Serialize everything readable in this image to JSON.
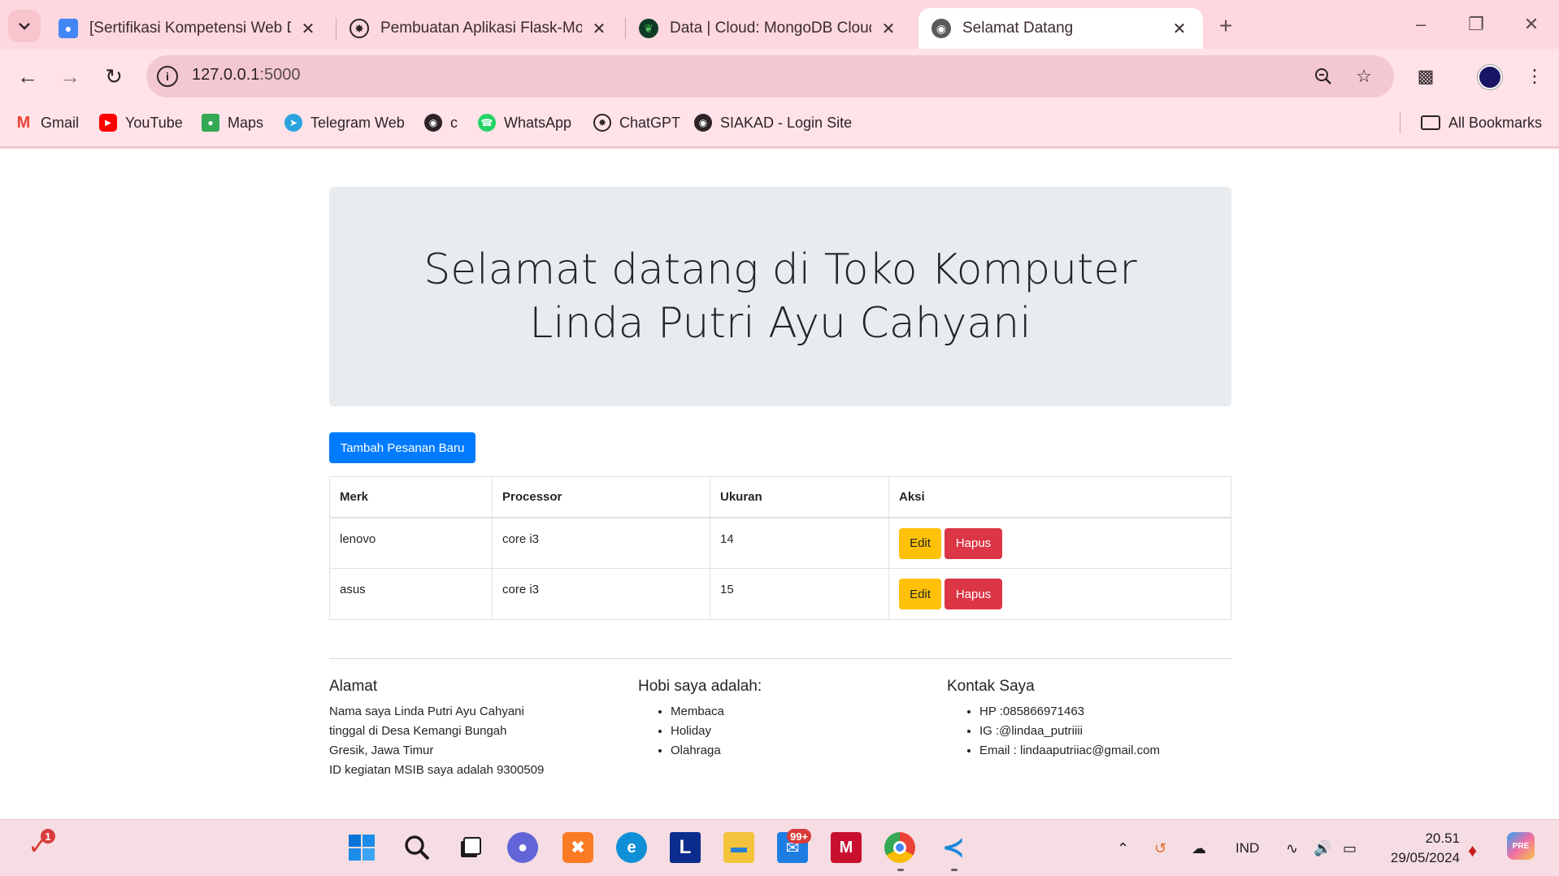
{
  "browser": {
    "tabs": [
      {
        "title": "[Sertifikasi Kompetensi Web De",
        "icon": "classroom-icon",
        "active": false
      },
      {
        "title": "Pembuatan Aplikasi Flask-Mong",
        "icon": "chatgpt-icon",
        "active": false
      },
      {
        "title": "Data | Cloud: MongoDB Cloud",
        "icon": "mongodb-leaf-icon",
        "active": false
      },
      {
        "title": "Selamat Datang",
        "icon": "globe-icon",
        "active": true
      }
    ],
    "url_host": "127.0.0.1",
    "url_port": ":5000",
    "bookmarks": [
      {
        "label": "Gmail",
        "icon": "gmail-icon"
      },
      {
        "label": "YouTube",
        "icon": "youtube-icon"
      },
      {
        "label": "Maps",
        "icon": "maps-icon"
      },
      {
        "label": "Telegram Web",
        "icon": "telegram-icon"
      },
      {
        "label": "c",
        "icon": "globe-icon"
      },
      {
        "label": "WhatsApp",
        "icon": "whatsapp-icon"
      },
      {
        "label": "ChatGPT",
        "icon": "chatgpt-icon"
      },
      {
        "label": "SIAKAD - Login Site",
        "icon": "globe-icon"
      }
    ],
    "all_bookmarks": "All Bookmarks"
  },
  "page": {
    "heading": "Selamat datang di Toko Komputer Linda Putri Ayu Cahyani",
    "add_button": "Tambah Pesanan Baru",
    "table": {
      "headers": [
        "Merk",
        "Processor",
        "Ukuran",
        "Aksi"
      ],
      "rows": [
        {
          "merk": "lenovo",
          "processor": "core i3",
          "ukuran": "14"
        },
        {
          "merk": "asus",
          "processor": "core i3",
          "ukuran": "15"
        }
      ],
      "edit_label": "Edit",
      "delete_label": "Hapus"
    },
    "footer": {
      "address_title": "Alamat",
      "address_lines": [
        "Nama saya Linda Putri Ayu Cahyani",
        "tinggal di Desa Kemangi Bungah",
        "Gresik, Jawa Timur",
        "ID kegiatan MSIB saya adalah 9300509"
      ],
      "hobby_title": "Hobi saya adalah:",
      "hobbies": [
        "Membaca",
        "Holiday",
        "Olahraga"
      ],
      "contact_title": "Kontak Saya",
      "contacts": [
        "HP :085866971463",
        "IG :@lindaa_putriiii",
        "Email : lindaaputriiac@gmail.com"
      ]
    }
  },
  "taskbar": {
    "notification_count": "1",
    "mail_badge": "99+",
    "language": "IND",
    "time": "20.51",
    "date": "29/05/2024"
  },
  "colors": {
    "chrome_bg": "#fdd8df",
    "primary": "#007bff",
    "warning": "#ffc107",
    "danger": "#dc3545",
    "jumbotron": "#e9ecef"
  }
}
